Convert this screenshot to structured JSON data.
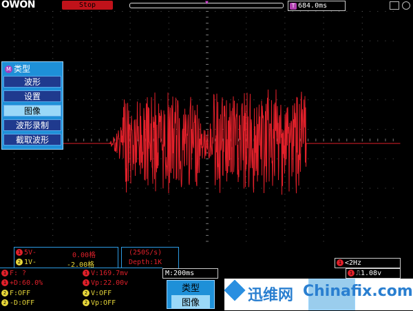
{
  "header": {
    "logo": "OWON",
    "run_status": "Stop",
    "trigger_position_icon": "T",
    "horizontal_position": "684.0ms"
  },
  "menu": {
    "title_badge": "M",
    "title": "类型",
    "items": [
      {
        "label": "波形",
        "selected": false
      },
      {
        "label": "设置",
        "selected": false
      },
      {
        "label": "图像",
        "selected": true
      },
      {
        "label": "波形录制",
        "selected": false
      },
      {
        "label": "截取波形",
        "selected": false
      }
    ]
  },
  "channel_info": {
    "ch1_badge": "1",
    "ch1_scale": "5V-",
    "ch1_offset": "0.00格",
    "ch2_badge": "2",
    "ch2_scale": "1V-",
    "ch2_offset": "-2.00格"
  },
  "acquisition": {
    "sample_rate": "(250S/s)",
    "depth": "Depth:1K"
  },
  "frequency": {
    "badge": "1",
    "value": "<2Hz"
  },
  "measurements": {
    "ch1_f": "F:  ?",
    "ch1_duty": "+D:60.0%",
    "ch1_v": "V:169.7mv",
    "ch1_vp": "Vp:22.00v",
    "ch2_f": "F:OFF",
    "ch2_duty": "-D:OFF",
    "ch2_v": "V:OFF",
    "ch2_vp": "Vp:OFF",
    "badge1": "1",
    "badge2": "2"
  },
  "timebase": "M:200ms",
  "trigger": {
    "badge": "1",
    "slope": "⎍",
    "level": "1.08v"
  },
  "type_button": {
    "line1": "类型",
    "line2": "图像"
  },
  "watermark": {
    "cn": "迅维网",
    "en": "Chinafix.com"
  },
  "colors": {
    "ch1": "#e0202a",
    "ch2": "#e8d83a",
    "grid": "#5a5a5a",
    "menu": "#1e90d8",
    "menu_selected": "#9ad8f8"
  }
}
